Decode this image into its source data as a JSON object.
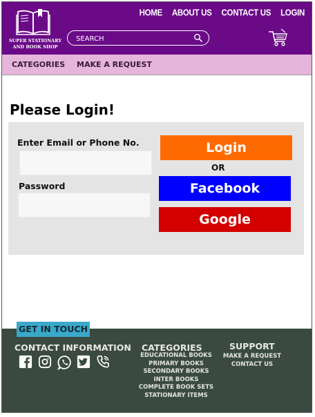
{
  "header": {
    "logo_line1": "SUPER STATIONARY",
    "logo_line2": "AND BOOK SHOP",
    "nav": [
      "HOME",
      "ABOUT US",
      "CONTACT US",
      "LOGIN"
    ],
    "search_placeholder": "SEARCH",
    "cart_icon": "cart-icon"
  },
  "subnav": {
    "categories": "CATEGORIES",
    "make_request": "MAKE A REQUEST"
  },
  "main": {
    "title": "Please Login!",
    "email_label": "Enter Email or Phone No.",
    "email_value": "",
    "password_label": "Password",
    "password_value": "",
    "login_button": "Login",
    "or_text": "OR",
    "facebook_button": "Facebook",
    "google_button": "Google"
  },
  "colors": {
    "header_bg": "#6a0a87",
    "subnav_bg": "#e6b5dc",
    "login_btn": "#ff6a00",
    "facebook_btn": "#0000ff",
    "google_btn": "#d40000",
    "footer_bg": "#3a4a40",
    "get_in_touch_bg": "#3aa8c9"
  },
  "footer": {
    "get_in_touch": "GET IN TOUCH",
    "contact_heading": "CONTACT INFORMATION",
    "social_icons": [
      "facebook-icon",
      "instagram-icon",
      "whatsapp-icon",
      "twitter-icon",
      "phone-icon"
    ],
    "categories_heading": "CATEGORIES",
    "categories": [
      "EDUCATIONAL BOOKS",
      "PRIMARY BOOKS",
      "SECONDARY BOOKS",
      "INTER BOOKS",
      "COMPLETE BOOK SETS",
      "STATIONARY ITEMS"
    ],
    "support_heading": "SUPPORT",
    "support": [
      "MAKE A REQUEST",
      "CONTACT US"
    ]
  }
}
